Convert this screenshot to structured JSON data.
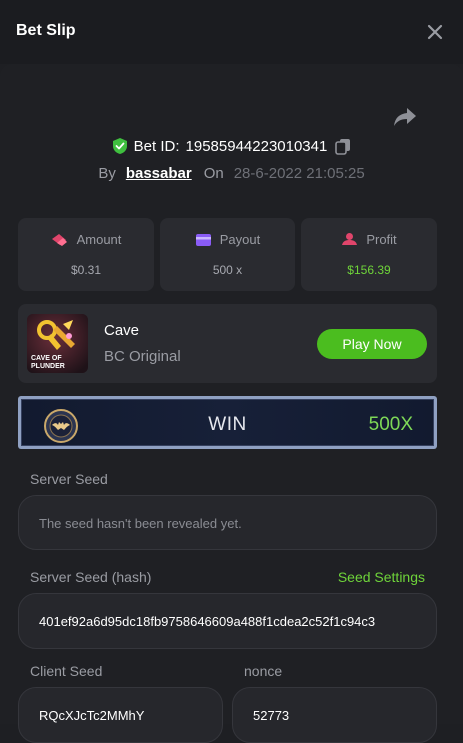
{
  "header": {
    "title": "Bet Slip",
    "close_icon": "close-icon"
  },
  "bet": {
    "id_label": "Bet ID:",
    "id": "19585944223010341",
    "by_label": "By",
    "user": "bassabar",
    "on_label": "On",
    "datetime": "28-6-2022 21:05:25"
  },
  "stats": {
    "amount_label": "Amount",
    "amount_value": "$0.31",
    "payout_label": "Payout",
    "payout_value": "500 x",
    "profit_label": "Profit",
    "profit_value": "$156.39",
    "profit_color": "#6fd43a"
  },
  "game": {
    "name": "Cave",
    "provider": "BC Original",
    "thumb_text_line1": "CAVE OF",
    "thumb_text_line2": "PLUNDER",
    "play_label": "Play Now",
    "play_color": "#4bbd1f"
  },
  "result": {
    "label": "WIN",
    "multiplier": "500X"
  },
  "seeds": {
    "server_label": "Server Seed",
    "server_placeholder": "The seed hasn't been revealed yet.",
    "hash_label": "Server Seed (hash)",
    "settings_link": "Seed Settings",
    "hash_value": "401ef92a6d95dc18fb9758646609a488f1cdea2c52f1c94c3",
    "client_label": "Client Seed",
    "client_value": "RQcXJcTc2MMhY",
    "nonce_label": "nonce",
    "nonce_value": "52773"
  }
}
